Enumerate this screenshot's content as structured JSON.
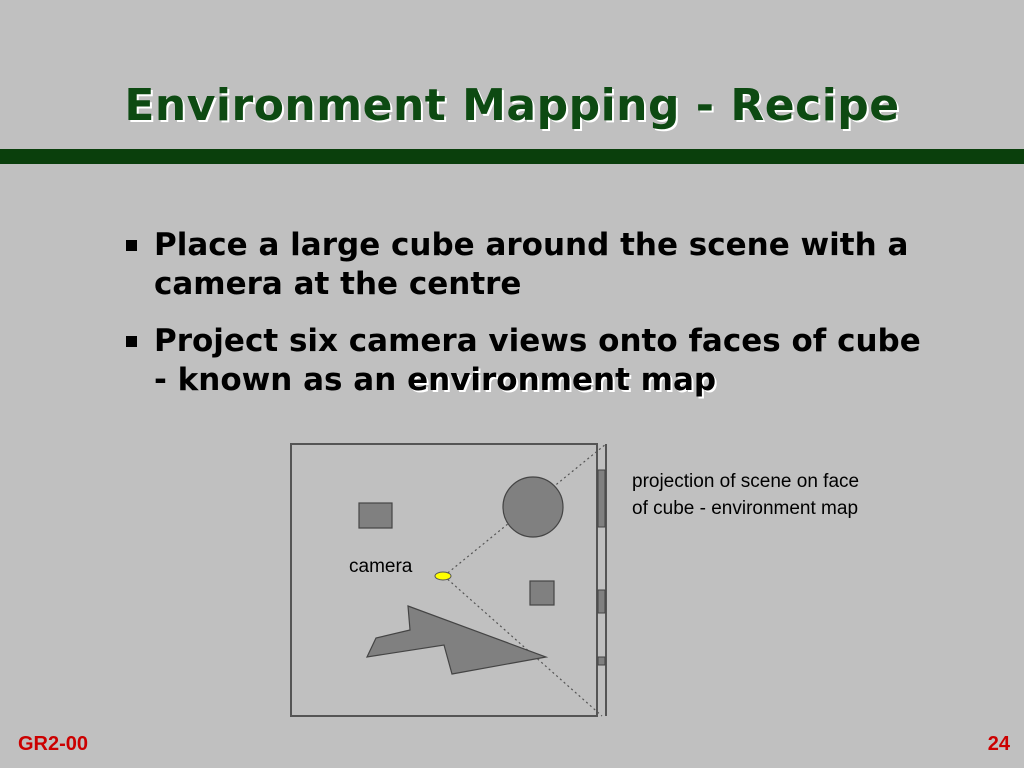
{
  "slide": {
    "title": "Environment Mapping - Recipe",
    "bullets": [
      {
        "text": "Place a large cube around the scene with a camera at the centre"
      },
      {
        "text_before": "Project six camera views onto faces of cube - known as an ",
        "emphasis": "environment map"
      }
    ],
    "diagram": {
      "camera_label": "camera",
      "caption": "projection of scene on face of cube - environment map"
    },
    "footer": {
      "course_code": "GR2-00",
      "page_number": "24"
    }
  },
  "colors": {
    "background": "#c0c0c0",
    "title": "#0d4a12",
    "title_bar": "#0a3f0c",
    "footer_text": "#cc0000",
    "shape_fill": "#808080",
    "camera_fill": "#ffff00"
  }
}
